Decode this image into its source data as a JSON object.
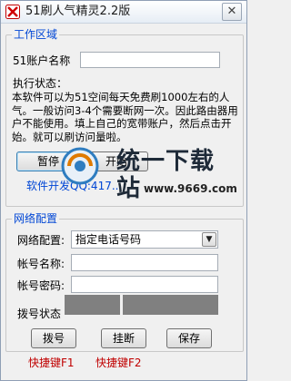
{
  "window": {
    "title": "51刷人气精灵2.2版",
    "close_glyph": "✕"
  },
  "work_area": {
    "legend": "工作区域",
    "account_label": "51账户名称",
    "account_value": "",
    "status_label": "执行状态：",
    "description": "本软件可以为51空间每天免费刷1000左右的人气。一般访问3-4个需要断网一次。因此路由器用户不能使用。填上自己的宽带账户，然后点击开始。就可以刷访问量啦。",
    "pause_button": "暂停",
    "start_button": "开始",
    "developer_label": "软件开发QQ:417..."
  },
  "network": {
    "legend": "网络配置",
    "config_label": "网络配置:",
    "config_value": "指定电话号码",
    "account_label": "帐号名称:",
    "account_value": "",
    "password_label": "帐号密码:",
    "password_value": "",
    "dial_status_label": "拨号状态",
    "dial_button": "拨号",
    "hangup_button": "挂断",
    "save_button": "保存"
  },
  "hotkeys": {
    "f1": "快捷键F1",
    "f2": "快捷键F2"
  },
  "watermark": {
    "text": "统一下载站",
    "url": "www.9669.com"
  },
  "colors": {
    "legend_blue": "#0046d5",
    "hotkey_red": "#c00000",
    "status_gray": "#808080"
  }
}
